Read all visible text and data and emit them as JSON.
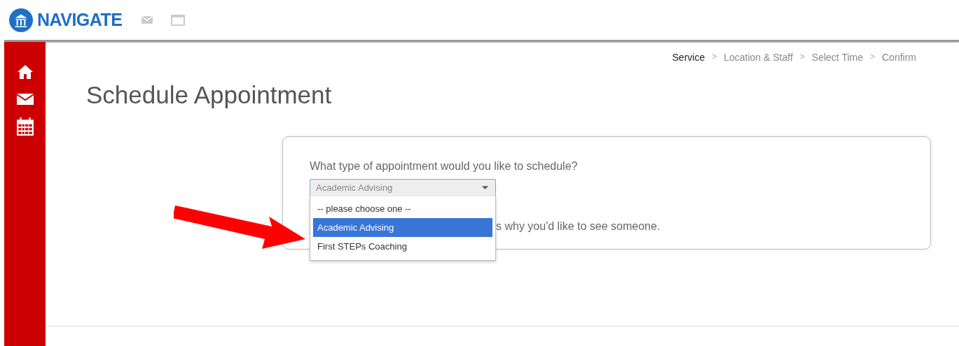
{
  "header": {
    "logo_text": "NAVIGATE"
  },
  "breadcrumb": [
    {
      "label": "Service",
      "selected": true
    },
    {
      "label": "Location & Staff",
      "selected": false
    },
    {
      "label": "Select Time",
      "selected": false
    },
    {
      "label": "Confirm",
      "selected": false
    }
  ],
  "breadcrumb_separator": ">",
  "page_title": "Schedule Appointment",
  "form": {
    "question": "What type of appointment would you like to schedule?",
    "select": {
      "value": "Academic Advising",
      "expanded": true,
      "options": [
        {
          "label": "-- please choose one --",
          "selected": false
        },
        {
          "label": "Academic Advising",
          "selected": true
        },
        {
          "label": "First STEPs Coaching",
          "selected": false
        }
      ]
    },
    "partial_prompt": "s why you'd like to see someone."
  }
}
